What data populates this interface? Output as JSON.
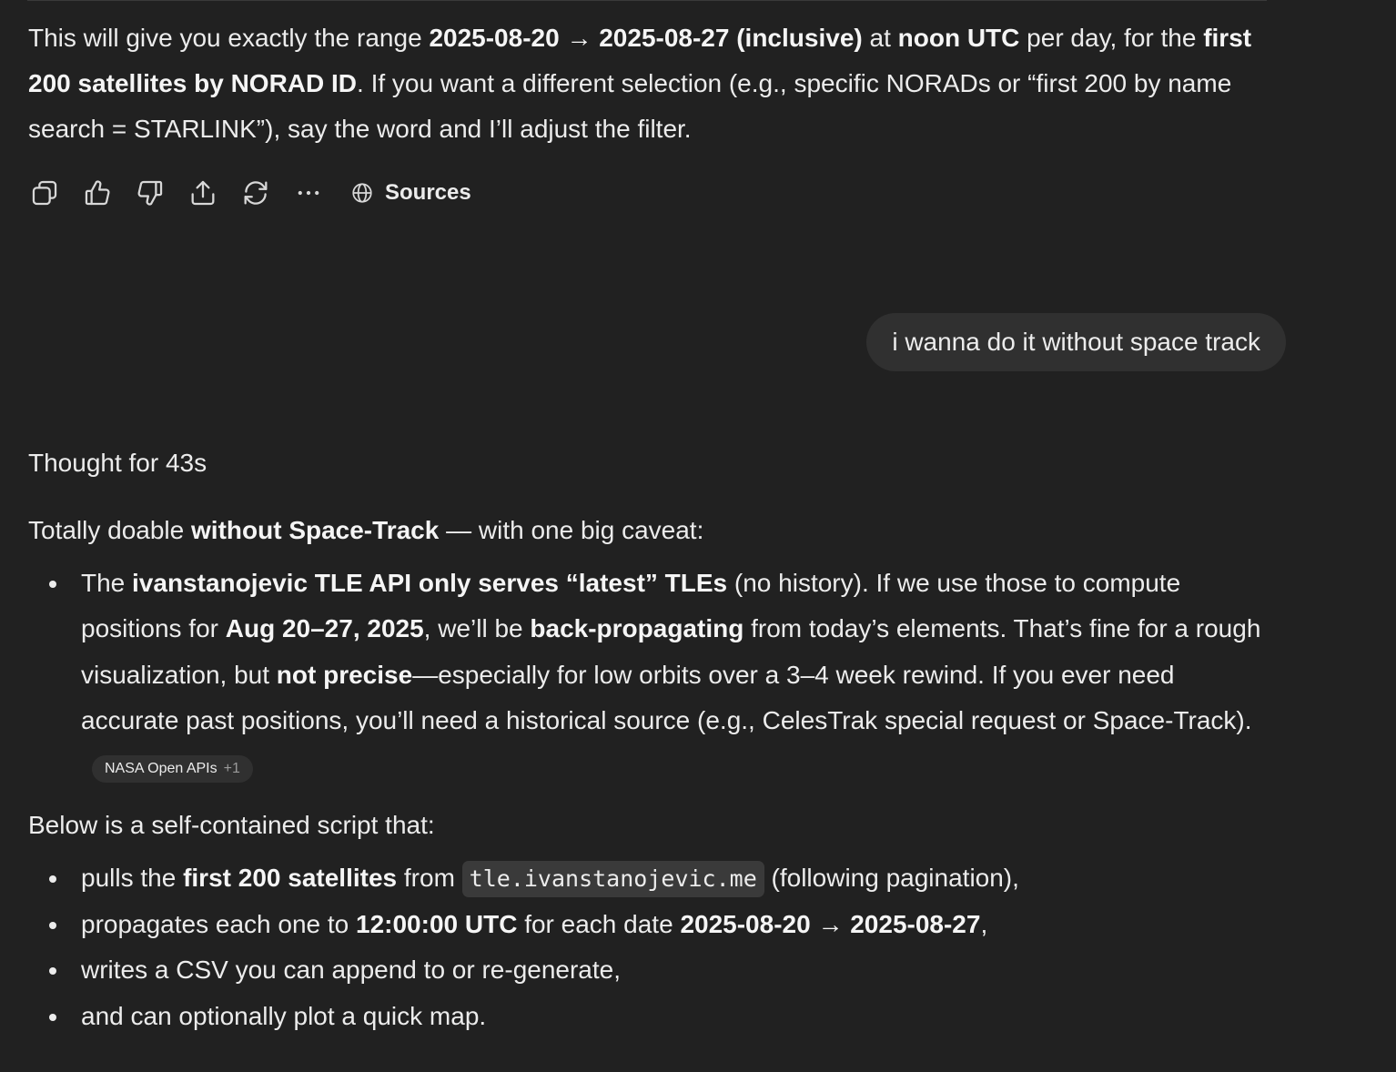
{
  "intro": {
    "t1": "This will give you exactly the range ",
    "b1": "2025-08-20 → 2025-08-27 (inclusive)",
    "t2": " at ",
    "b2": "noon UTC",
    "t3": " per day, for the ",
    "b3": "first 200 satellites by NORAD ID",
    "t4": ". If you want a different selection (e.g., specific NORADs or “first 200 by name search = STARLINK”), say the word and I’ll adjust the filter."
  },
  "actions": {
    "icons": [
      "copy-icon",
      "thumbs-up-icon",
      "thumbs-down-icon",
      "share-icon",
      "regenerate-icon",
      "more-icon"
    ],
    "sources_label": "Sources"
  },
  "user_message": "i wanna do it without space track",
  "thought_label": "Thought for 43s",
  "caveat": {
    "t1": "Totally doable ",
    "b1": "without Space-Track",
    "t2": " — with one big caveat:"
  },
  "caveat_bullet": {
    "t1": "The ",
    "b1": "ivanstanojevic TLE API only serves “latest” TLEs",
    "t2": " (no history). If we use those to compute positions for ",
    "b2": "Aug 20–27, 2025",
    "t3": ", we’ll be ",
    "b3": "back-propagating",
    "t4": " from today’s elements. That’s fine for a rough visualization, but ",
    "b4": "not precise",
    "t5": "—especially for low orbits over a 3–4 week rewind. If you ever need accurate past positions, you’ll need a historical source (e.g., CelesTrak special request or Space-Track).",
    "cite_label": "NASA Open APIs",
    "cite_more": "+1"
  },
  "below_label": "Below is a self-contained script that:",
  "script_bullets": {
    "b1": {
      "t1": "pulls the ",
      "b1": "first 200 satellites",
      "t2": " from ",
      "code": "tle.ivanstanojevic.me",
      "t3": " (following pagination),"
    },
    "b2": {
      "t1": "propagates each one to ",
      "b1": "12:00:00 UTC",
      "t2": " for each date ",
      "b2": "2025-08-20 → 2025-08-27",
      "t3": ","
    },
    "b3": {
      "t1": "writes a CSV you can append to or re-generate,"
    },
    "b4": {
      "t1": "and can optionally plot a quick map."
    }
  }
}
